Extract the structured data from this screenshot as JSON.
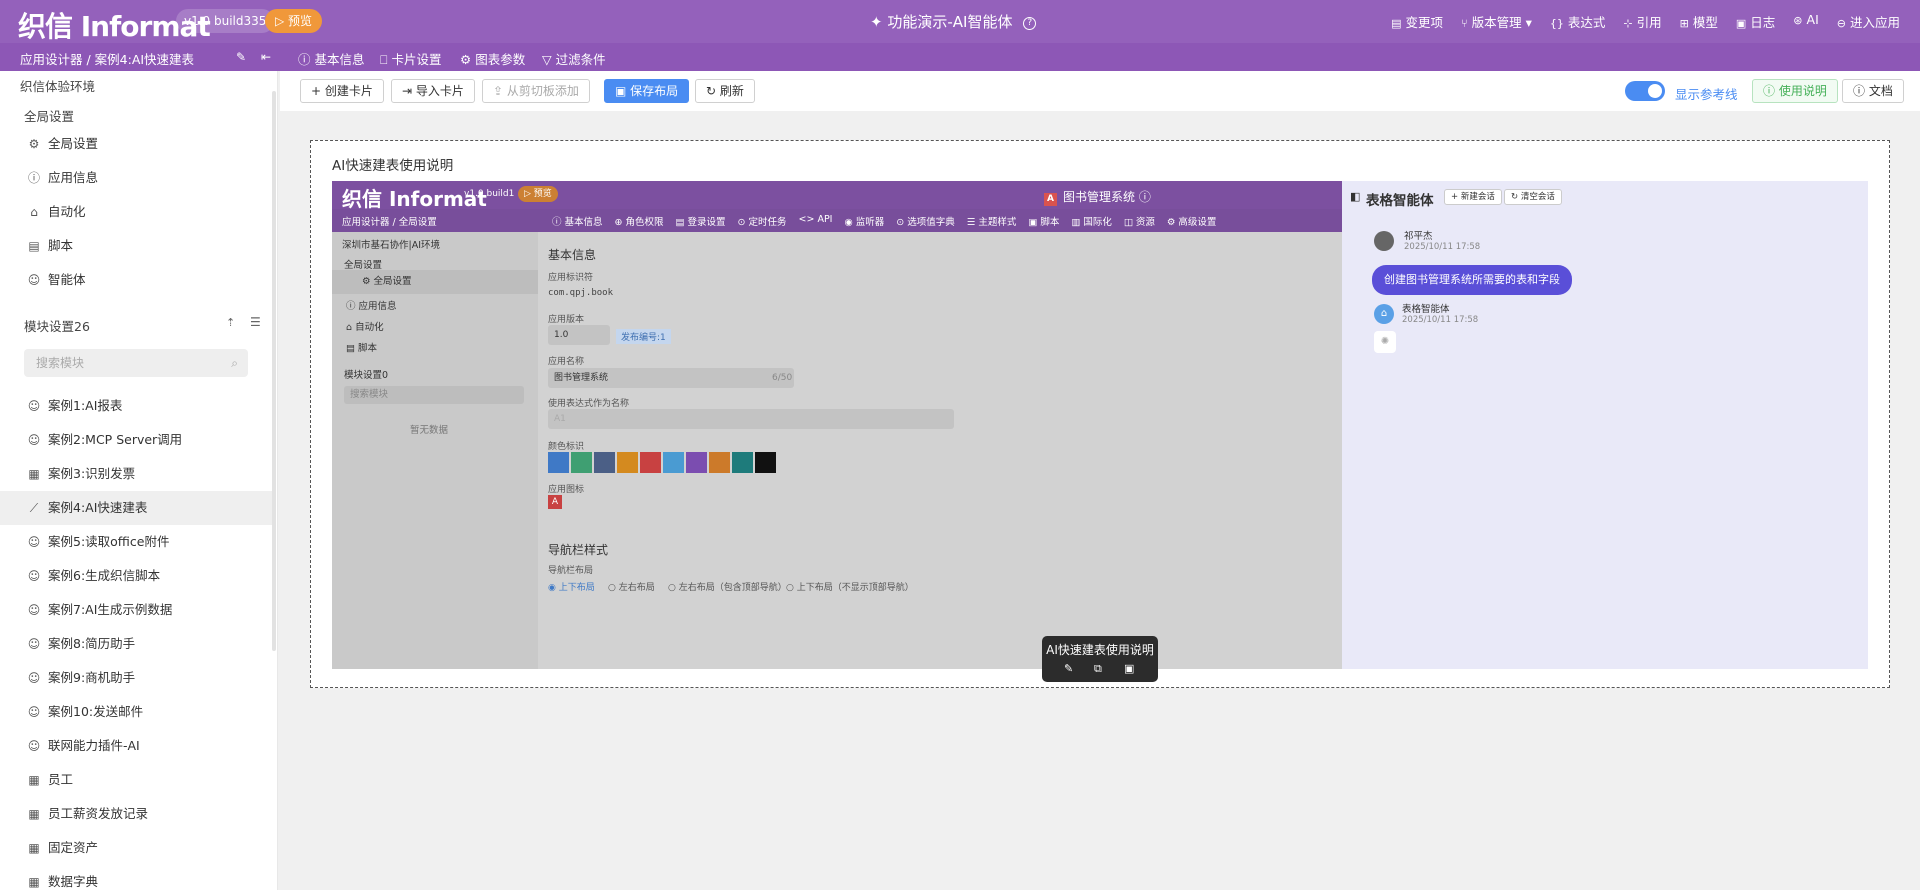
{
  "header": {
    "logo": "织信 Informat",
    "version": "v1.0 build335",
    "preview": "▷ 预览",
    "title": "功能演示-AI智能体",
    "nav": [
      {
        "icon": "▤",
        "label": "变更项"
      },
      {
        "icon": "⑂",
        "label": "版本管理 ▾"
      },
      {
        "icon": "{}",
        "label": "表达式"
      },
      {
        "icon": "⊹",
        "label": "引用"
      },
      {
        "icon": "⊞",
        "label": "模型"
      },
      {
        "icon": "▣",
        "label": "日志"
      },
      {
        "icon": "⊛",
        "label": "AI"
      },
      {
        "icon": "⊖",
        "label": "进入应用"
      }
    ]
  },
  "subheader": {
    "breadcrumb": "应用设计器 / 案例4:AI快速建表",
    "tabs": [
      "基本信息",
      "卡片设置",
      "图表参数",
      "过滤条件"
    ],
    "tab_icons": [
      "ⓘ",
      "⎕",
      "⚙",
      "▽"
    ]
  },
  "sidebar": {
    "env": "织信体验环境",
    "global_settings_group": "全局设置",
    "global_items": [
      {
        "icon": "⚙",
        "label": "全局设置"
      },
      {
        "icon": "ⓘ",
        "label": "应用信息"
      },
      {
        "icon": "⌂",
        "label": "自动化"
      },
      {
        "icon": "▤",
        "label": "脚本"
      },
      {
        "icon": "☺",
        "label": "智能体"
      }
    ],
    "module_group": "模块设置26",
    "search_placeholder": "搜索模块",
    "modules": [
      {
        "icon": "☺",
        "label": "案例1:AI报表"
      },
      {
        "icon": "☺",
        "label": "案例2:MCP Server调用"
      },
      {
        "icon": "▦",
        "label": "案例3:识别发票"
      },
      {
        "icon": "⟋",
        "label": "案例4:AI快速建表"
      },
      {
        "icon": "☺",
        "label": "案例5:读取office附件"
      },
      {
        "icon": "☺",
        "label": "案例6:生成织信脚本"
      },
      {
        "icon": "☺",
        "label": "案例7:AI生成示例数据"
      },
      {
        "icon": "☺",
        "label": "案例8:简历助手"
      },
      {
        "icon": "☺",
        "label": "案例9:商机助手"
      },
      {
        "icon": "☺",
        "label": "案例10:发送邮件"
      },
      {
        "icon": "☺",
        "label": "联网能力插件-AI"
      },
      {
        "icon": "▦",
        "label": "员工"
      },
      {
        "icon": "▦",
        "label": "员工薪资发放记录"
      },
      {
        "icon": "▦",
        "label": "固定资产"
      },
      {
        "icon": "▦",
        "label": "数据字典"
      }
    ],
    "selected_module": "案例4:AI快速建表"
  },
  "toolbar": {
    "create_card": "+ 创建卡片",
    "import_card": "⇥ 导入卡片",
    "paste_clipboard": "⇪ 从剪切板添加",
    "save_layout": "▣ 保存布局",
    "refresh": "↻ 刷新",
    "show_guides": "显示参考线",
    "usage": "ⓘ 使用说明",
    "docs": "ⓘ 文档"
  },
  "card": {
    "title": "AI快速建表使用说明",
    "screenshot": {
      "logo": "织信 Informat",
      "version": "v1.0 build1",
      "preview": "▷ 预览",
      "app_title": "图书管理系统",
      "app_badge": "A",
      "breadcrumb": "应用设计器 / 全局设置",
      "tabs": [
        "ⓘ 基本信息",
        "⊕ 角色权限",
        "▤ 登录设置",
        "⊙ 定时任务",
        "<> API",
        "◉ 监听器",
        "⊙ 选项值字典",
        "☰ 主题样式",
        "▣ 脚本",
        "▥ 国际化",
        "◫ 资源",
        "⚙ 高级设置"
      ],
      "side_env": "深圳市基石协作|AI环境",
      "side_global": "全局设置",
      "side_items": [
        "全局设置",
        "应用信息",
        "自动化",
        "脚本"
      ],
      "side_module": "模块设置0",
      "side_search": "搜索模块",
      "side_empty": "暂无数据",
      "main_heading": "基本信息",
      "app_id_label": "应用标识符",
      "app_id": "com.qpj.book",
      "app_version_label": "应用版本",
      "app_version": "1.0",
      "build_badge": "发布编号:1",
      "app_name_label": "应用名称",
      "app_name": "图书管理系统",
      "app_name_count": "6/50",
      "expr_label": "使用表达式作为名称",
      "expr_value": "A1",
      "color_label": "颜色标识",
      "colors": [
        "#3f79c6",
        "#3f9f72",
        "#4b5f86",
        "#d48a1f",
        "#c84141",
        "#4a9bd2",
        "#7b4db0",
        "#cc7a2a",
        "#1e7b7b",
        "#111111"
      ],
      "icon_label": "应用图标",
      "nav_style": "导航栏样式",
      "nav_layout_label": "导航栏布局",
      "nav_options": [
        "上下布局",
        "左右布局",
        "左右布局（包含顶部导航）",
        "上下布局（不显示顶部导航）"
      ],
      "agent_title": "表格智能体",
      "new_chat": "+ 新建会话",
      "clear_chat": "↻ 清空会话",
      "user_name": "祁平杰",
      "user_time": "2025/10/11 17:58",
      "user_msg": "创建图书管理系统所需要的表和字段",
      "bot_name": "表格智能体",
      "bot_time": "2025/10/11 17:58"
    }
  },
  "tooltip": {
    "title": "AI快速建表使用说明",
    "icons": [
      "edit-icon",
      "copy-icon",
      "delete-icon"
    ]
  }
}
